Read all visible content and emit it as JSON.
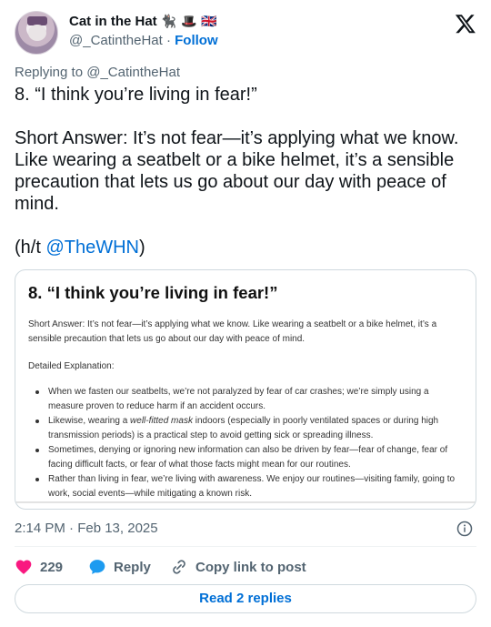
{
  "author": {
    "display_name": "Cat in the Hat",
    "emojis": "🐈‍⬛ 🎩 🇬🇧",
    "handle": "@_CatintheHat",
    "separator": "·",
    "follow_label": "Follow"
  },
  "reply_context": "Replying to @_CatintheHat",
  "tweet": {
    "text_main": "8. “I think you’re living in fear!”\n\nShort Answer: It’s not fear—it’s applying what we know. Like wearing a seatbelt or a bike helmet, it’s a sensible precaution that lets us go about our day with peace of mind.\n\n(h/t ",
    "mention": "@TheWHN",
    "text_tail": ")"
  },
  "card": {
    "title": "8. “I think you’re living in fear!”",
    "short_answer": "Short Answer: It’s not fear—it’s applying what we know. Like wearing a seatbelt or a bike helmet, it’s a sensible precaution that lets us go about our day with peace of mind.",
    "detailed_label": "Detailed Explanation:",
    "bullets": [
      "When we fasten our seatbelts, we’re not paralyzed by fear of car crashes; we’re simply using a measure proven to reduce harm if an accident occurs.",
      "Likewise, wearing a ",
      "Sometimes, denying or ignoring new information can also be driven by fear—fear of change, fear of facing difficult facts, or fear of what those facts might mean for our routines.",
      "Rather than living in fear, we’re living with awareness. We enjoy our routines—visiting family, going to work, social events—while mitigating a known risk."
    ],
    "bullet2_em": "well-fitted mask",
    "bullet2_rest": " indoors (especially in poorly ventilated spaces or during high transmission periods) is a practical step to avoid getting sick or spreading illness."
  },
  "timestamp": "2:14 PM · Feb 13, 2025",
  "actions": {
    "like_count": "229",
    "reply_label": "Reply",
    "copy_label": "Copy link to post"
  },
  "read_replies_label": "Read 2 replies",
  "colors": {
    "accent": "#006fd6",
    "like": "#f91880",
    "reply_icon": "#1d9bf0",
    "muted": "#536471"
  },
  "icons": [
    "x-logo-icon",
    "heart-icon",
    "speech-bubble-icon",
    "link-icon",
    "info-icon"
  ]
}
